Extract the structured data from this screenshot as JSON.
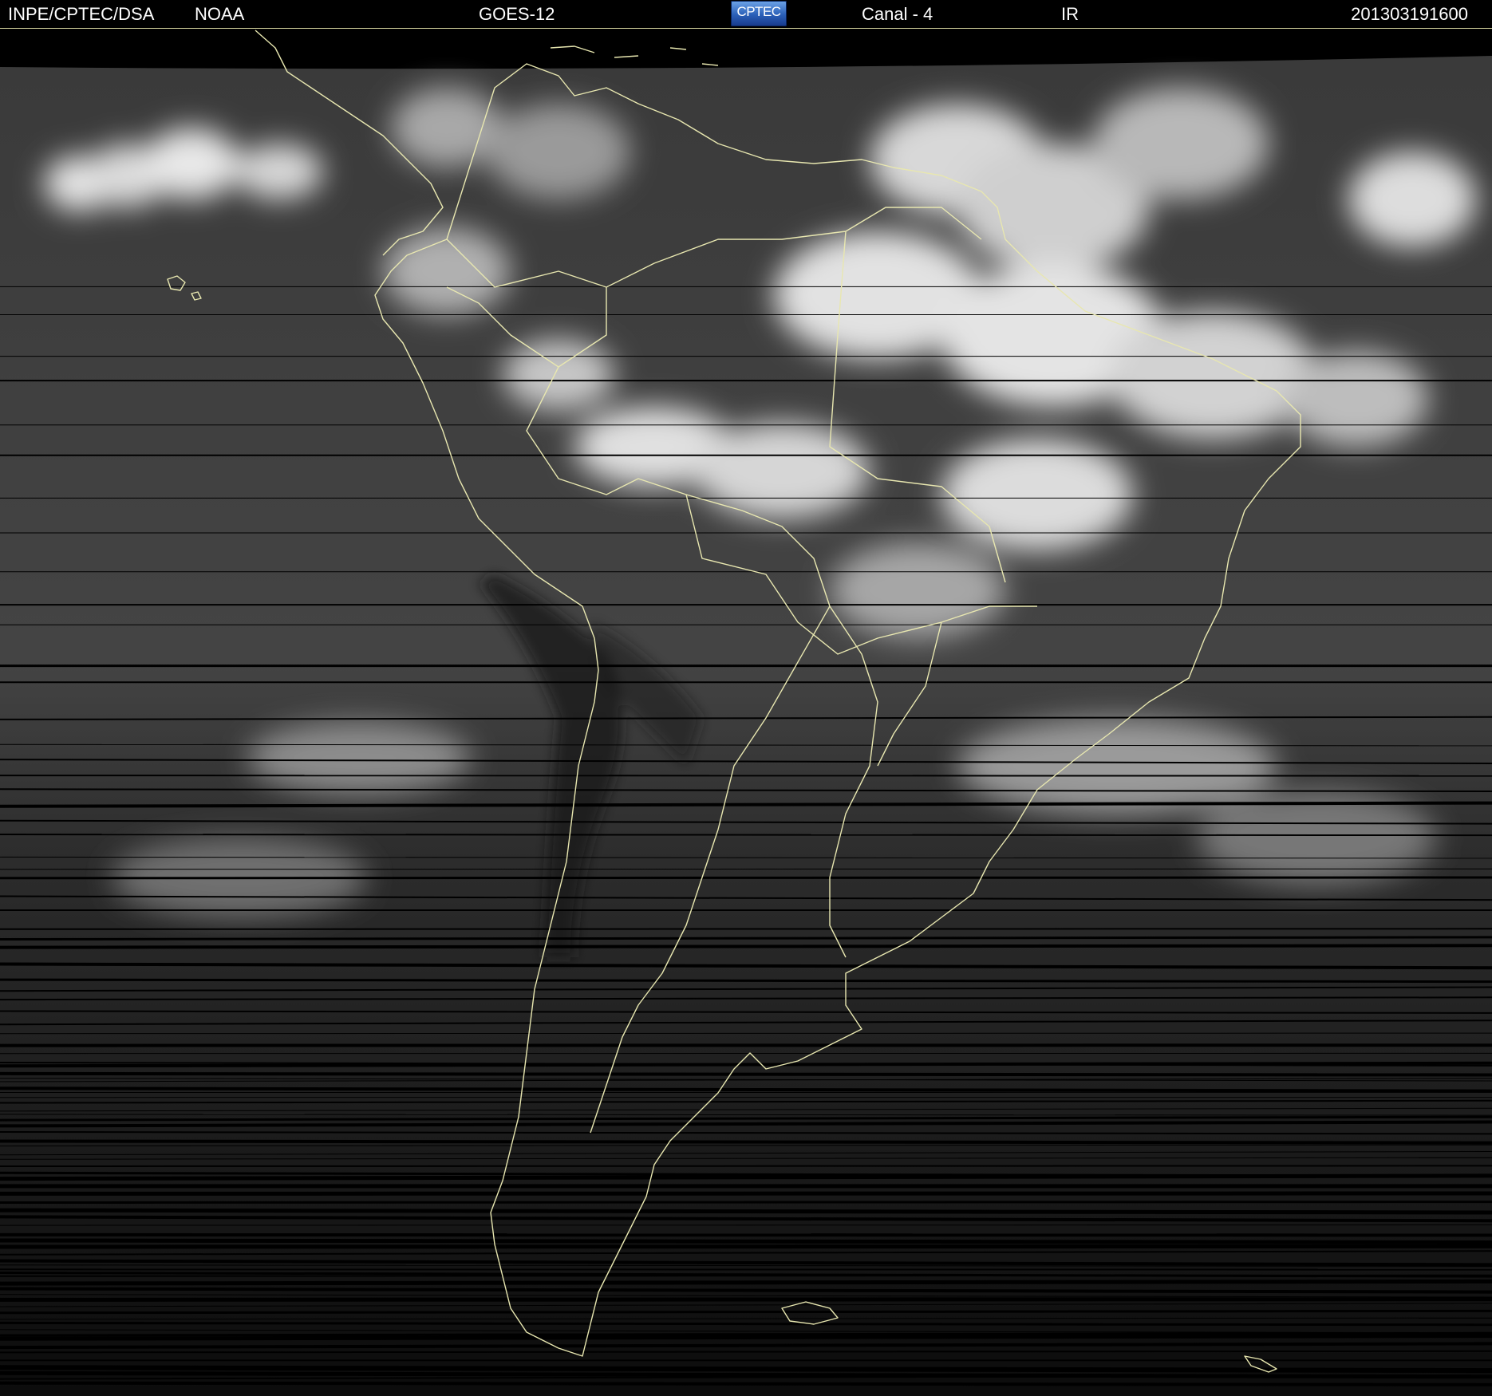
{
  "header": {
    "source": "INPE/CPTEC/DSA",
    "agency": "NOAA",
    "satellite": "GOES-12",
    "logo_text": "CPTEC",
    "channel": "Canal - 4",
    "band": "IR",
    "timestamp": "201303191600"
  },
  "colors": {
    "background": "#000000",
    "coastline": "#e8e7b0",
    "header_text": "#ffffff",
    "logo_blue": "#2a5fb8"
  },
  "imagery": {
    "description_icon": "satellite-ir-image"
  }
}
